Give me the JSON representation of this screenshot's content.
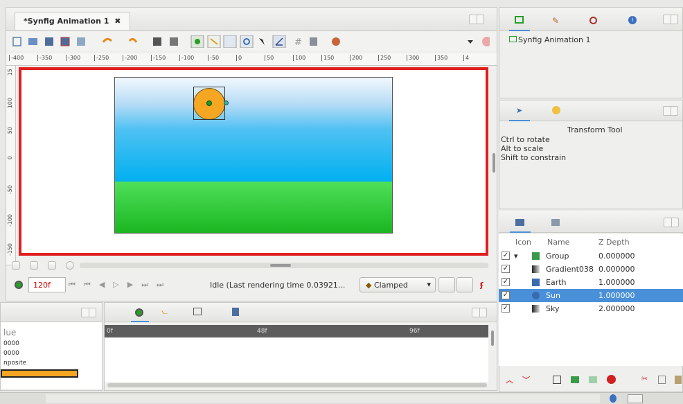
{
  "canvas_tab": {
    "title": "*Synfig Animation 1"
  },
  "ruler": {
    "labels": [
      "-400",
      "-350",
      "-300",
      "-250",
      "-200",
      "-150",
      "-100",
      "-50",
      "0",
      "50",
      "100",
      "150",
      "200",
      "250",
      "300",
      "350",
      "4"
    ]
  },
  "vruler": {
    "labels": [
      "15",
      "100",
      "50",
      "0",
      "-50",
      "-100",
      "-150"
    ]
  },
  "playback": {
    "end_time": "120f",
    "status": "Idle (Last rendering time 0.03921...",
    "interpolation": "Clamped"
  },
  "canvas_browser": {
    "item": "Synfig Animation 1"
  },
  "tool_options": {
    "title": "Transform Tool",
    "hints": [
      "Ctrl to rotate",
      "Alt to scale",
      "Shift to constrain"
    ]
  },
  "layers": {
    "headers": {
      "icon": "Icon",
      "name": "Name",
      "zdepth": "Z Depth"
    },
    "rows": [
      {
        "name": "Group",
        "zdepth": "0.000000",
        "icon": "folder-icon",
        "checked": true,
        "expanded": true,
        "selected": false
      },
      {
        "name": "Gradient038",
        "zdepth": "0.000000",
        "icon": "gradient-icon",
        "checked": true,
        "selected": false
      },
      {
        "name": "Earth",
        "zdepth": "1.000000",
        "icon": "rectangle-icon",
        "checked": true,
        "selected": false
      },
      {
        "name": "Sun",
        "zdepth": "1.000000",
        "icon": "circle-icon",
        "checked": true,
        "selected": true
      },
      {
        "name": "Sky",
        "zdepth": "2.000000",
        "icon": "gradient-icon",
        "checked": true,
        "selected": false
      }
    ]
  },
  "params": {
    "header": "lue",
    "values": [
      "0000",
      "0000",
      "nposite"
    ]
  },
  "timetrack": {
    "marks": [
      "0f",
      "48f",
      "96f"
    ]
  },
  "colors": {
    "selection": "#4a90d9",
    "accent_red": "#e02020",
    "sun": "#f5a623",
    "sky_top": "#f2f8fd",
    "sky_bottom": "#00b0f0",
    "grass_top": "#4fe05a",
    "grass_bottom": "#19b520"
  }
}
